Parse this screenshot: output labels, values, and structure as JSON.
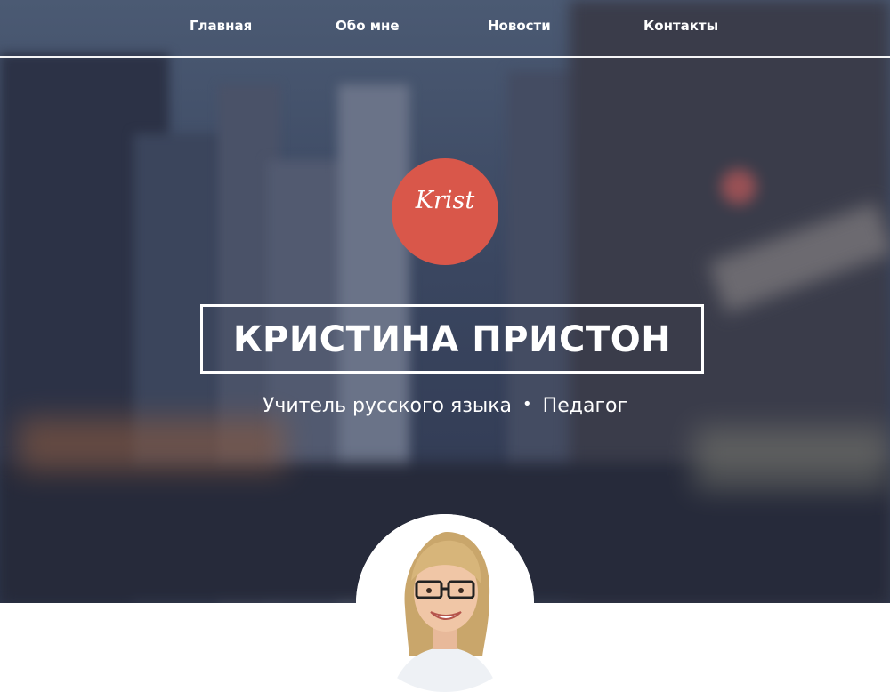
{
  "nav": {
    "items": [
      {
        "label": "Главная"
      },
      {
        "label": "Обо мне"
      },
      {
        "label": "Новости"
      },
      {
        "label": "Контакты"
      }
    ]
  },
  "hero": {
    "logo_text": "Krist",
    "name": "КРИСТИНА ПРИСТОН",
    "subtitle": {
      "role1": "Учитель русского языка",
      "separator": "•",
      "role2": "Педагог"
    }
  },
  "colors": {
    "accent": "#d9574a",
    "overlay": "#3a4660",
    "text": "#ffffff"
  },
  "avatar": {
    "icon": "profile-photo"
  }
}
